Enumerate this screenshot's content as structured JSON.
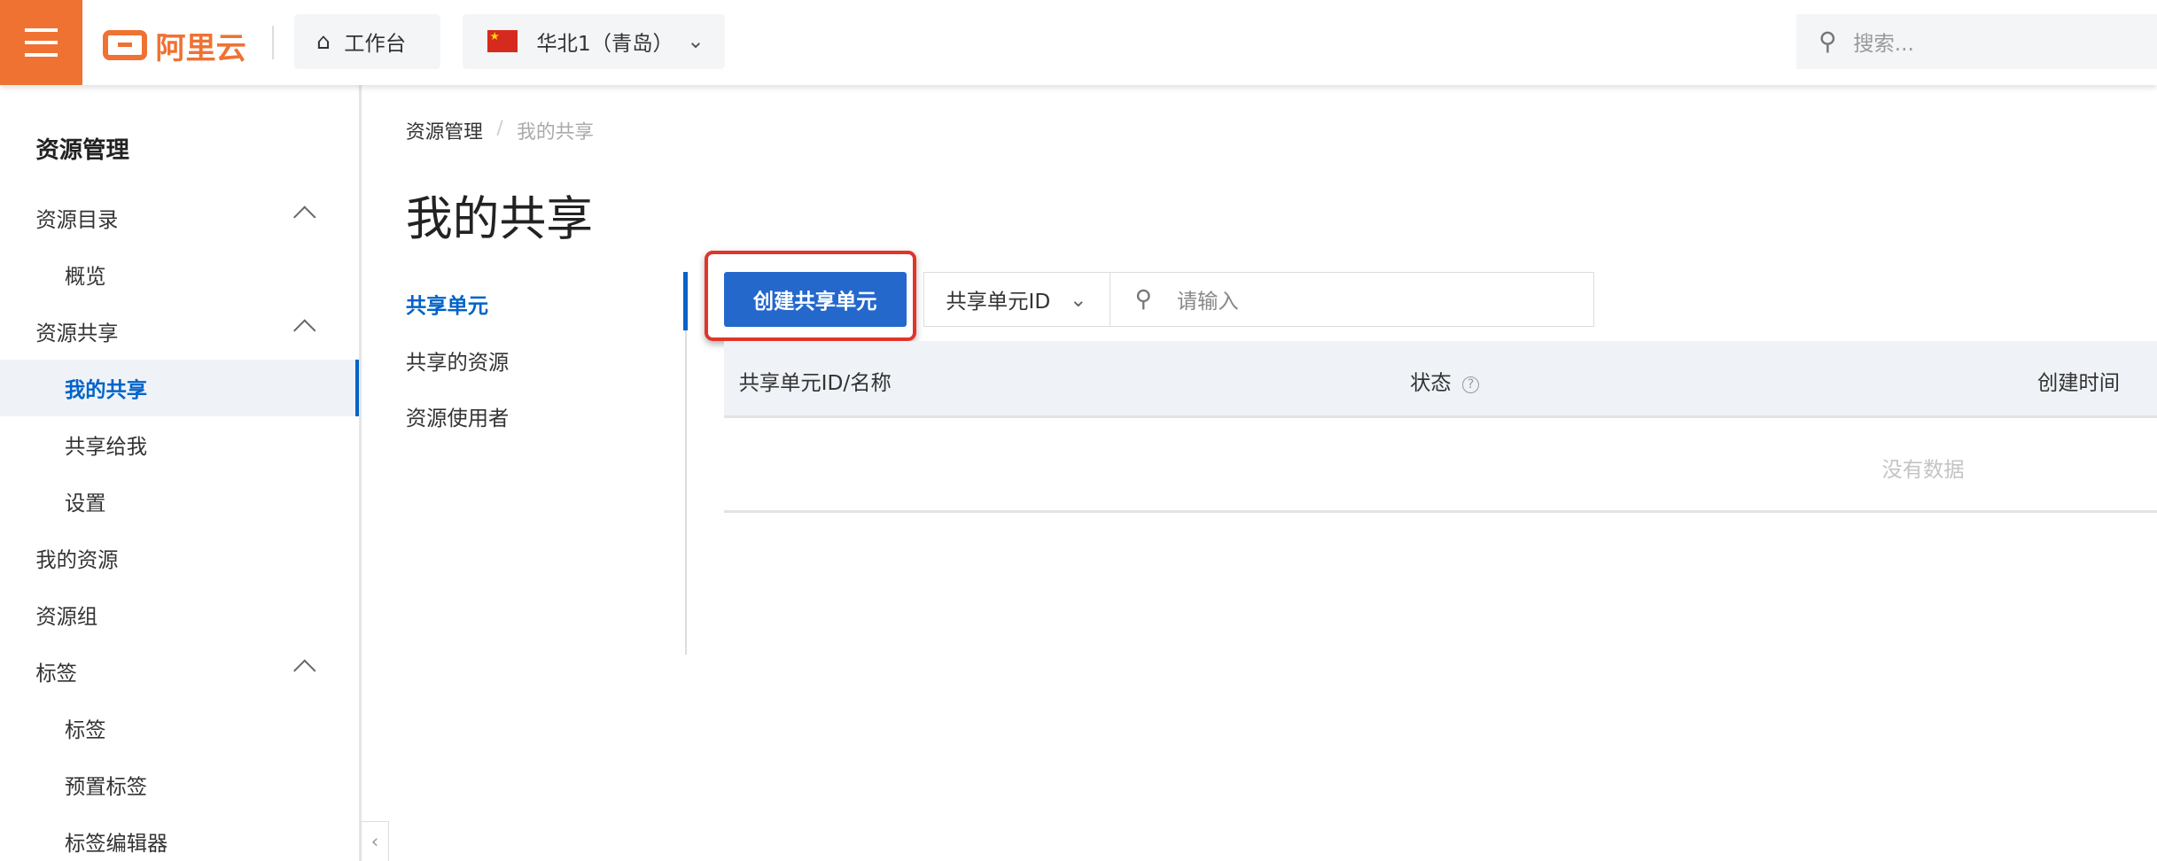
{
  "header": {
    "logo_text": "阿里云",
    "workbench_label": "工作台",
    "region_label": "华北1（青岛）",
    "search_placeholder": "搜索..."
  },
  "sidebar": {
    "title": "资源管理",
    "items": [
      {
        "label": "资源目录",
        "level": 1,
        "expanded": true
      },
      {
        "label": "概览",
        "level": 2
      },
      {
        "label": "资源共享",
        "level": 1,
        "expanded": true
      },
      {
        "label": "我的共享",
        "level": 2,
        "active": true
      },
      {
        "label": "共享给我",
        "level": 2
      },
      {
        "label": "设置",
        "level": 2
      },
      {
        "label": "我的资源",
        "level": 1
      },
      {
        "label": "资源组",
        "level": 1
      },
      {
        "label": "标签",
        "level": 1,
        "expanded": true
      },
      {
        "label": "标签",
        "level": 2
      },
      {
        "label": "预置标签",
        "level": 2
      },
      {
        "label": "标签编辑器",
        "level": 2
      }
    ]
  },
  "breadcrumb": [
    "资源管理",
    "我的共享"
  ],
  "page_title": "我的共享",
  "subnav": [
    "共享单元",
    "共享的资源",
    "资源使用者"
  ],
  "toolbar": {
    "create_label": "创建共享单元",
    "filter_select": "共享单元ID",
    "search_placeholder": "请输入"
  },
  "table": {
    "columns": [
      "共享单元ID/名称",
      "状态",
      "创建时间"
    ],
    "empty_text": "没有数据"
  },
  "colors": {
    "brand": "#ef7233",
    "primary": "#2468cc",
    "highlight": "#e0352b"
  }
}
